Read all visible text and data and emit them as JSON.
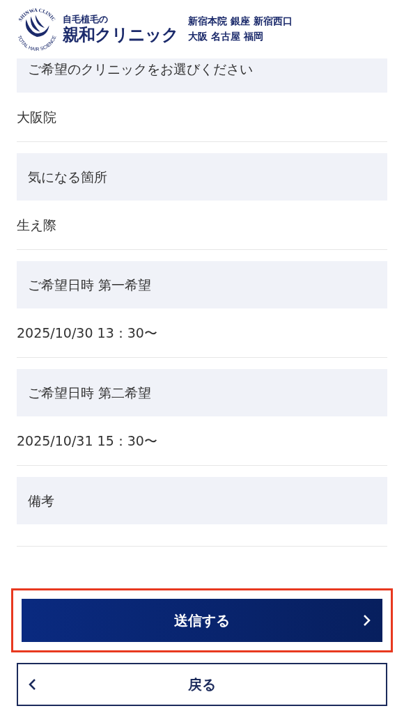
{
  "header": {
    "emblem_top": "SHINWA CLINIC",
    "emblem_bottom": "TOTAL HAIR SCIENCE",
    "tagline": "自毛植毛の",
    "brand": "親和クリニック",
    "locations": [
      "新宿本院 銀座 新宿西口",
      "大阪 名古屋 福岡"
    ]
  },
  "fields": [
    {
      "label": "ご希望のクリニックをお選びください",
      "value": "大阪院"
    },
    {
      "label": "気になる箇所",
      "value": "生え際"
    },
    {
      "label": "ご希望日時 第一希望",
      "value": "2025/10/30 13：30〜"
    },
    {
      "label": "ご希望日時 第二希望",
      "value": "2025/10/31 15：30〜"
    },
    {
      "label": "備考"
    }
  ],
  "submit_button": {
    "label": "送信する",
    "highlighted": true
  },
  "back_button": {
    "label": "戻る"
  }
}
